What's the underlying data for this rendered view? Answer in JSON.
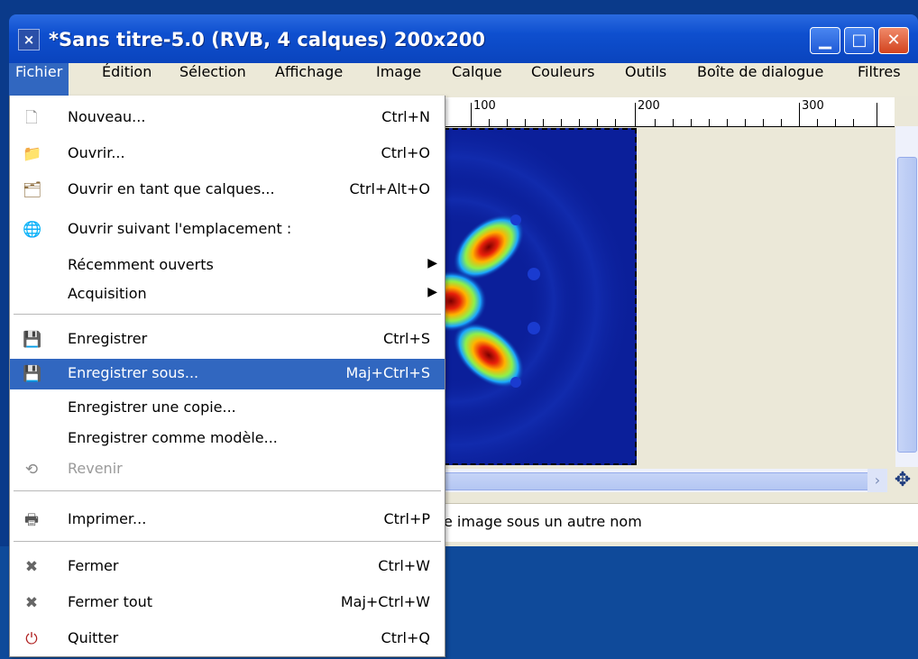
{
  "window": {
    "title": "*Sans titre-5.0 (RVB, 4 calques) 200x200",
    "app_icon": "×",
    "minimize_glyph": "▁",
    "maximize_glyph": "□",
    "close_glyph": "✕"
  },
  "menubar": {
    "items": [
      "Fichier",
      "Édition",
      "Sélection",
      "Affichage",
      "Image",
      "Calque",
      "Couleurs",
      "Outils",
      "Boîte de dialogue",
      "Filtres"
    ],
    "active": "Fichier"
  },
  "ruler": {
    "labels": [
      "100",
      "200",
      "300"
    ]
  },
  "statusbar": {
    "text": "e image sous un autre nom"
  },
  "scroll": {
    "arrow_right": "›",
    "navigate_icon": "✥"
  },
  "file_menu": {
    "items": [
      {
        "label": "Nouveau...",
        "shortcut": "Ctrl+N",
        "icon": "new-document-icon",
        "glyph": "🗋"
      },
      {
        "label": "Ouvrir...",
        "shortcut": "Ctrl+O",
        "icon": "open-folder-icon",
        "glyph": "📁"
      },
      {
        "label": "Ouvrir en tant que calques...",
        "shortcut": "Ctrl+Alt+O",
        "icon": "open-layers-icon",
        "glyph": "🗂"
      },
      {
        "label": "Ouvrir suivant l'emplacement :",
        "shortcut": "",
        "icon": "globe-icon",
        "glyph": "🌐"
      },
      {
        "label": "Récemment ouverts",
        "submenu": "▶"
      },
      {
        "label": "Acquisition",
        "submenu": "▶"
      },
      {
        "label": "Enregistrer",
        "shortcut": "Ctrl+S",
        "icon": "save-icon",
        "glyph": "💾"
      },
      {
        "label": "Enregistrer sous...",
        "shortcut": "Maj+Ctrl+S",
        "icon": "save-as-icon",
        "glyph": "💾"
      },
      {
        "label": "Enregistrer une copie..."
      },
      {
        "label": "Enregistrer comme modèle..."
      },
      {
        "label": "Revenir",
        "icon": "revert-icon",
        "glyph": "⟲"
      },
      {
        "label": "Imprimer...",
        "shortcut": "Ctrl+P",
        "icon": "printer-icon",
        "glyph": "🖶"
      },
      {
        "label": "Fermer",
        "shortcut": "Ctrl+W",
        "icon": "close-icon",
        "glyph": "✖"
      },
      {
        "label": "Fermer tout",
        "shortcut": "Maj+Ctrl+W",
        "icon": "close-all-icon",
        "glyph": "✖"
      },
      {
        "label": "Quitter",
        "shortcut": "Ctrl+Q",
        "icon": "quit-icon",
        "glyph": "⏻"
      }
    ]
  }
}
